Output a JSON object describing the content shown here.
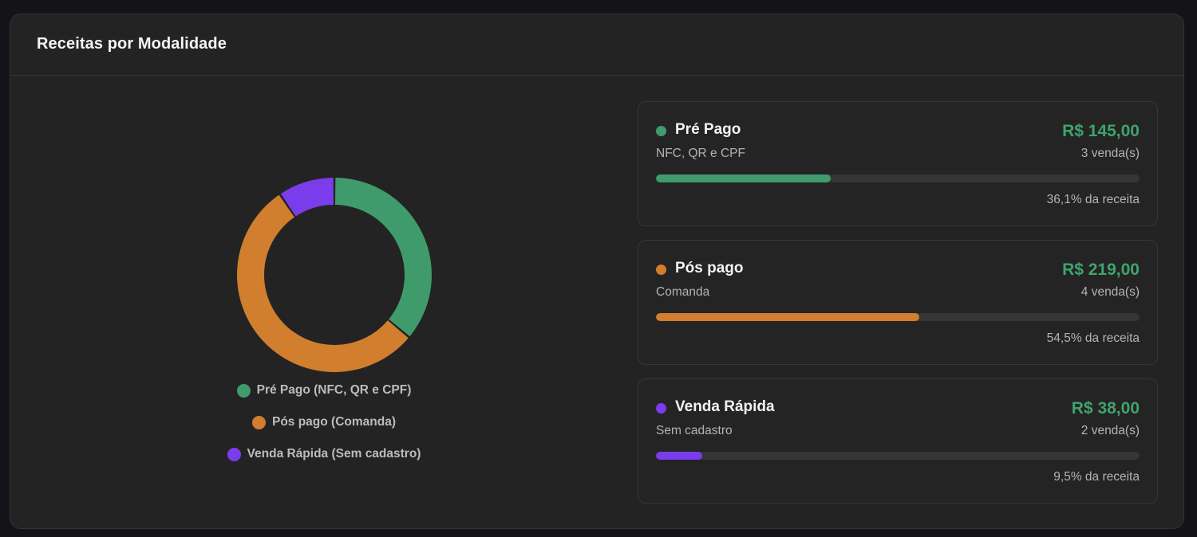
{
  "card": {
    "title": "Receitas por Modalidade"
  },
  "chart_data": {
    "type": "pie",
    "style": "donut",
    "categories": [
      "Pré Pago (NFC, QR e CPF)",
      "Pós pago (Comanda)",
      "Venda Rápida (Sem cadastro)"
    ],
    "values": [
      145.0,
      219.0,
      38.0
    ],
    "colors": [
      "#3f9b6c",
      "#d17e2e",
      "#7b3cec"
    ],
    "legend_position": "bottom"
  },
  "legend": [
    {
      "label": "Pré Pago (NFC, QR e CPF)",
      "color": "#3f9b6c"
    },
    {
      "label": "Pós pago (Comanda)",
      "color": "#d17e2e"
    },
    {
      "label": "Venda Rápida (Sem cadastro)",
      "color": "#7b3cec"
    }
  ],
  "modalities": [
    {
      "name": "Pré Pago",
      "subtitle": "NFC, QR e CPF",
      "amount": "R$ 145,00",
      "count": "3 venda(s)",
      "percent_label": "36,1% da receita",
      "share": 0.361,
      "color": "#3f9b6c"
    },
    {
      "name": "Pós pago",
      "subtitle": "Comanda",
      "amount": "R$ 219,00",
      "count": "4 venda(s)",
      "percent_label": "54,5% da receita",
      "share": 0.545,
      "color": "#d17e2e"
    },
    {
      "name": "Venda Rápida",
      "subtitle": "Sem cadastro",
      "amount": "R$ 38,00",
      "count": "2 venda(s)",
      "percent_label": "9,5% da receita",
      "share": 0.095,
      "color": "#7b3cec"
    }
  ]
}
